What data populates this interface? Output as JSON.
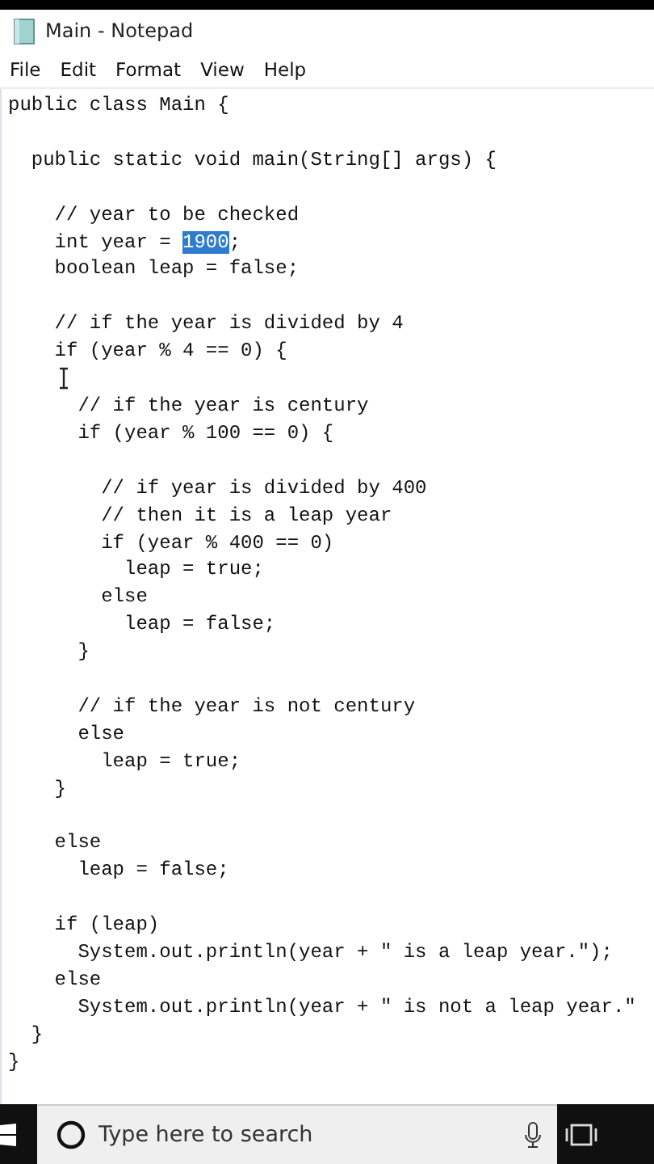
{
  "window": {
    "title": "Main - Notepad"
  },
  "menu": [
    {
      "label": "File"
    },
    {
      "label": "Edit"
    },
    {
      "label": "Format"
    },
    {
      "label": "View"
    },
    {
      "label": "Help"
    }
  ],
  "editor": {
    "lines": [
      {
        "kind": "code",
        "text": "public class Main {"
      },
      {
        "kind": "blank"
      },
      {
        "kind": "code",
        "text": "  public static void main(String[] args) {"
      },
      {
        "kind": "blank"
      },
      {
        "kind": "code",
        "text": "    // year to be checked"
      },
      {
        "kind": "segments",
        "segments": [
          {
            "text": "    int year = ",
            "selected": false
          },
          {
            "text": "1900",
            "selected": true
          },
          {
            "text": ";",
            "selected": false
          }
        ]
      },
      {
        "kind": "code",
        "text": "    boolean leap = false;"
      },
      {
        "kind": "blank"
      },
      {
        "kind": "code",
        "text": "    // if the year is divided by 4"
      },
      {
        "kind": "code",
        "text": "    if (year % 4 == 0) {"
      },
      {
        "kind": "blank"
      },
      {
        "kind": "code",
        "text": "      // if the year is century"
      },
      {
        "kind": "code",
        "text": "      if (year % 100 == 0) {"
      },
      {
        "kind": "blank"
      },
      {
        "kind": "code",
        "text": "        // if year is divided by 400"
      },
      {
        "kind": "code",
        "text": "        // then it is a leap year"
      },
      {
        "kind": "code",
        "text": "        if (year % 400 == 0)"
      },
      {
        "kind": "code",
        "text": "          leap = true;"
      },
      {
        "kind": "code",
        "text": "        else"
      },
      {
        "kind": "code",
        "text": "          leap = false;"
      },
      {
        "kind": "code",
        "text": "      }"
      },
      {
        "kind": "blank"
      },
      {
        "kind": "code",
        "text": "      // if the year is not century"
      },
      {
        "kind": "code",
        "text": "      else"
      },
      {
        "kind": "code",
        "text": "        leap = true;"
      },
      {
        "kind": "code",
        "text": "    }"
      },
      {
        "kind": "blank"
      },
      {
        "kind": "code",
        "text": "    else"
      },
      {
        "kind": "code",
        "text": "      leap = false;"
      },
      {
        "kind": "blank"
      },
      {
        "kind": "code",
        "text": "    if (leap)"
      },
      {
        "kind": "code",
        "text": "      System.out.println(year + \" is a leap year.\");"
      },
      {
        "kind": "code",
        "text": "    else"
      },
      {
        "kind": "code",
        "text": "      System.out.println(year + \" is not a leap year.\""
      },
      {
        "kind": "code",
        "text": "  }"
      },
      {
        "kind": "code",
        "text": "}"
      }
    ]
  },
  "taskbar": {
    "search": {
      "placeholder": "Type here to search"
    }
  }
}
